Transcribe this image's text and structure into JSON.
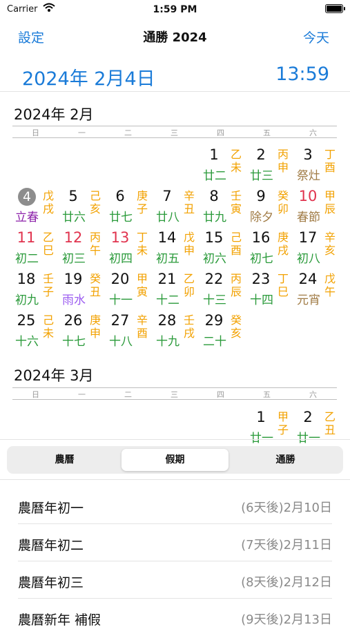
{
  "status": {
    "carrier": "Carrier",
    "time": "1:59 PM"
  },
  "nav": {
    "settings": "設定",
    "title": "通勝 2024",
    "today": "今天"
  },
  "dateline": {
    "date": "2024年 2月4日",
    "time": "13:59"
  },
  "weekdays": [
    "日",
    "一",
    "二",
    "三",
    "四",
    "五",
    "六"
  ],
  "months": [
    {
      "title": "2024年 2月",
      "days": [
        {
          "n": "1",
          "lunar": "廿二",
          "gz": "乙未"
        },
        {
          "n": "2",
          "lunar": "廿三",
          "gz": "丙申"
        },
        {
          "n": "3",
          "lunar": "祭灶",
          "gz": "丁酉"
        },
        {
          "n": "4",
          "lunar": "立春",
          "gz": "戊戌"
        },
        {
          "n": "5",
          "lunar": "廿六",
          "gz": "己亥"
        },
        {
          "n": "6",
          "lunar": "廿七",
          "gz": "庚子"
        },
        {
          "n": "7",
          "lunar": "廿八",
          "gz": "辛丑"
        },
        {
          "n": "8",
          "lunar": "廿九",
          "gz": "壬寅"
        },
        {
          "n": "9",
          "lunar": "除夕",
          "gz": "癸卯"
        },
        {
          "n": "10",
          "lunar": "春節",
          "gz": "甲辰"
        },
        {
          "n": "11",
          "lunar": "初二",
          "gz": "乙巳"
        },
        {
          "n": "12",
          "lunar": "初三",
          "gz": "丙午"
        },
        {
          "n": "13",
          "lunar": "初四",
          "gz": "丁未"
        },
        {
          "n": "14",
          "lunar": "初五",
          "gz": "戊申"
        },
        {
          "n": "15",
          "lunar": "初六",
          "gz": "己酉"
        },
        {
          "n": "16",
          "lunar": "初七",
          "gz": "庚戌"
        },
        {
          "n": "17",
          "lunar": "初八",
          "gz": "辛亥"
        },
        {
          "n": "18",
          "lunar": "初九",
          "gz": "壬子"
        },
        {
          "n": "19",
          "lunar": "雨水",
          "gz": "癸丑"
        },
        {
          "n": "20",
          "lunar": "十一",
          "gz": "甲寅"
        },
        {
          "n": "21",
          "lunar": "十二",
          "gz": "乙卯"
        },
        {
          "n": "22",
          "lunar": "十三",
          "gz": "丙辰"
        },
        {
          "n": "23",
          "lunar": "十四",
          "gz": "丁巳"
        },
        {
          "n": "24",
          "lunar": "元宵",
          "gz": "戊午"
        },
        {
          "n": "25",
          "lunar": "十六",
          "gz": "己未"
        },
        {
          "n": "26",
          "lunar": "十七",
          "gz": "庚申"
        },
        {
          "n": "27",
          "lunar": "十八",
          "gz": "辛酉"
        },
        {
          "n": "28",
          "lunar": "十九",
          "gz": "壬戌"
        },
        {
          "n": "29",
          "lunar": "二十",
          "gz": "癸亥"
        }
      ]
    },
    {
      "title": "2024年 3月",
      "days": [
        {
          "n": "1",
          "lunar": "廿一",
          "gz": "甲子"
        },
        {
          "n": "2",
          "lunar": "廿一",
          "gz": "乙丑"
        }
      ]
    }
  ],
  "segments": [
    "農曆",
    "假期",
    "通勝"
  ],
  "holidays": [
    {
      "name": "農曆年初一",
      "when": "(6天後)2月10日"
    },
    {
      "name": "農曆年初二",
      "when": "(7天後)2月11日"
    },
    {
      "name": "農曆年初三",
      "when": "(8天後)2月12日"
    },
    {
      "name": "農曆新年 補假",
      "when": "(9天後)2月13日"
    }
  ]
}
